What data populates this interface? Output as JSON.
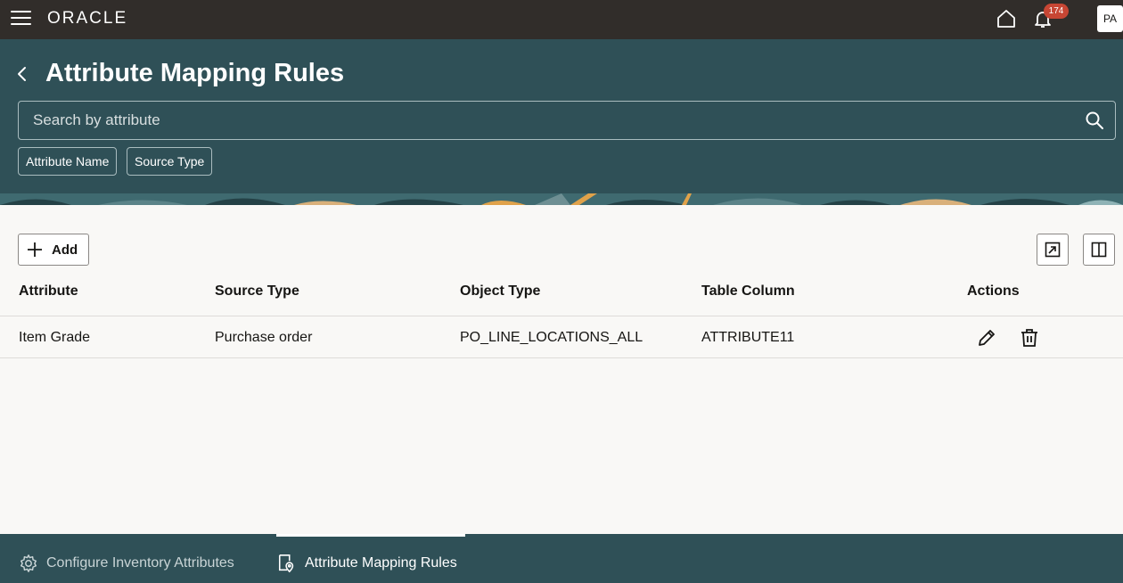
{
  "global_header": {
    "logo": "ORACLE",
    "notifications_count": "174",
    "avatar_initials": "PA"
  },
  "page": {
    "title": "Attribute Mapping Rules"
  },
  "search": {
    "placeholder": "Search by attribute",
    "value": ""
  },
  "filter_chips": [
    "Attribute Name",
    "Source Type"
  ],
  "toolbar": {
    "add_label": "Add"
  },
  "table": {
    "columns": [
      "Attribute",
      "Source Type",
      "Object Type",
      "Table Column",
      "Actions"
    ],
    "rows": [
      {
        "attribute": "Item Grade",
        "source_type": "Purchase order",
        "object_type": "PO_LINE_LOCATIONS_ALL",
        "table_column": "ATTRIBUTE11"
      }
    ]
  },
  "bottom_tabs": [
    {
      "label": "Configure Inventory Attributes",
      "icon": "gear-icon",
      "active": false
    },
    {
      "label": "Attribute Mapping Rules",
      "icon": "mapping-rules-icon",
      "active": true
    }
  ],
  "colors": {
    "top_bar": "#312d2a",
    "header": "#2f5057",
    "content_bg": "#f9f8f6",
    "badge": "#c74634"
  }
}
